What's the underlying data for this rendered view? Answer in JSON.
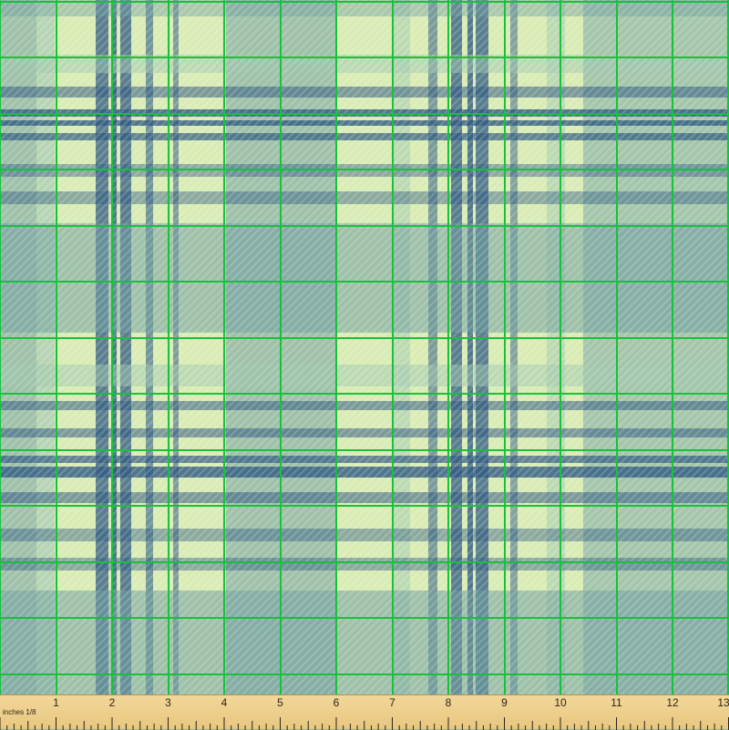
{
  "fabric": {
    "colors": {
      "ground_light": "#d9ecb4",
      "sage": "#9fc7b0",
      "teal": "#6f9fa0",
      "navy": "#2f5a82",
      "grid_green": "#16c23a"
    }
  },
  "ruler": {
    "unit_label": "inches 1/8",
    "numbers": [
      "1",
      "2",
      "3",
      "4",
      "5",
      "6",
      "7",
      "8",
      "9",
      "10",
      "11",
      "12",
      "13"
    ]
  }
}
